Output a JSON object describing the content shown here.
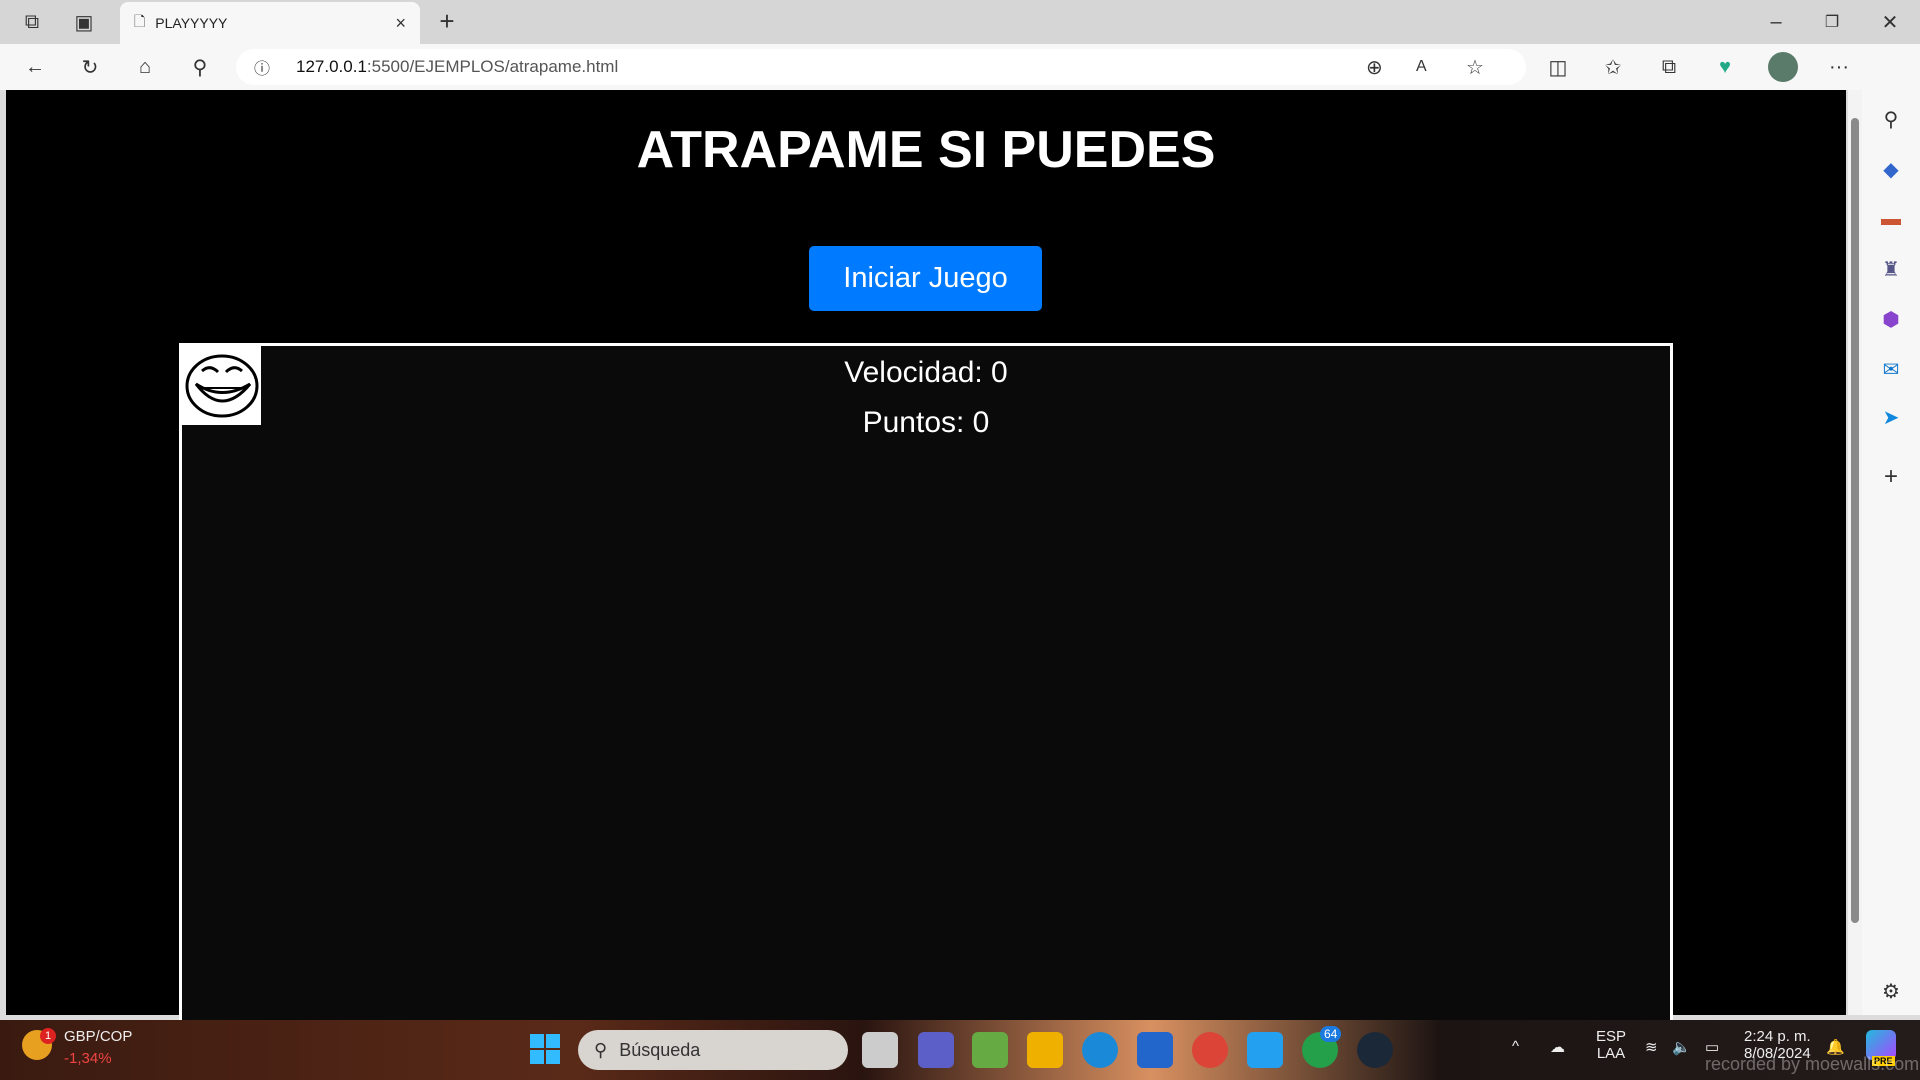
{
  "browser": {
    "tab_title": "PLAYYYYY",
    "url_host": "127.0.0.1",
    "url_path": ":5500/EJEMPLOS/atrapame.html",
    "new_tab": "+",
    "close": "×",
    "more": "···"
  },
  "page": {
    "title": "ATRAPAME SI PUEDES",
    "start_button": "Iniciar Juego",
    "velocidad_label": "Velocidad: 0",
    "puntos_label": "Puntos: 0"
  },
  "taskbar": {
    "widget_pair": "GBP/COP",
    "widget_change": "-1,34%",
    "widget_badge": "1",
    "search_placeholder": "Búsqueda",
    "whatsapp_badge": "64",
    "lang1": "ESP",
    "lang2": "LAA",
    "time": "2:24 p. m.",
    "date": "8/08/2024",
    "copilot_badge": "PRE",
    "watermark": "recorded by moewalls.com"
  },
  "colors": {
    "accent": "#007bff",
    "bg": "#000000"
  }
}
